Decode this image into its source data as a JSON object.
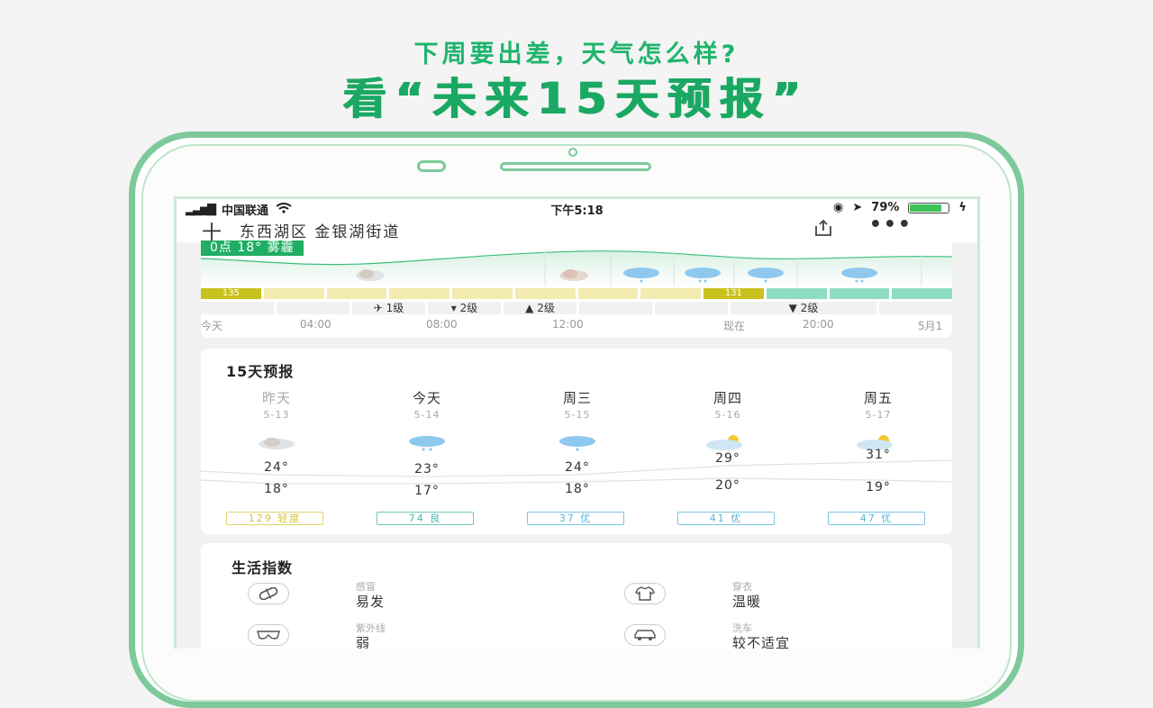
{
  "promo": {
    "line1": "下周要出差，天气怎么样?",
    "line2": "看“未来15天预报”"
  },
  "status": {
    "carrier": "中国联通",
    "time": "下午5:18",
    "battery": "79%"
  },
  "nav": {
    "plus": "十",
    "location": "东西湖区 金银湖街道",
    "more": "•••"
  },
  "hourly": {
    "badge": "0点 18° 雾霾",
    "aqi_start": "135",
    "aqi_now": "131",
    "wind": [
      "1级",
      "2级",
      "2级",
      "2级"
    ],
    "times": [
      "今天",
      "04:00",
      "08:00",
      "12:00",
      "现在",
      "20:00",
      "5月1"
    ]
  },
  "forecast": {
    "title": "15天预报",
    "days": [
      {
        "day": "昨天",
        "date": "5-13",
        "high": "24°",
        "low": "18°",
        "aqi": "129 轻度",
        "icon": "haze-icon"
      },
      {
        "day": "今天",
        "date": "5-14",
        "high": "23°",
        "low": "17°",
        "aqi": "74 良",
        "icon": "rain-icon"
      },
      {
        "day": "周三",
        "date": "5-15",
        "high": "24°",
        "low": "18°",
        "aqi": "37 优",
        "icon": "light-rain-icon"
      },
      {
        "day": "周四",
        "date": "5-16",
        "high": "29°",
        "low": "20°",
        "aqi": "41 优",
        "icon": "partly-sunny-icon"
      },
      {
        "day": "周五",
        "date": "5-17",
        "high": "31°",
        "low": "19°",
        "aqi": "47 优",
        "icon": "partly-sunny-icon"
      }
    ]
  },
  "life": {
    "title": "生活指数",
    "items": [
      {
        "label": "感冒",
        "value": "易发",
        "icon": "pill-icon"
      },
      {
        "label": "穿衣",
        "value": "温暖",
        "icon": "tshirt-icon"
      },
      {
        "label": "紫外线",
        "value": "弱",
        "icon": "sunglasses-icon"
      },
      {
        "label": "洗车",
        "value": "较不适宜",
        "icon": "car-icon"
      }
    ]
  },
  "colors": {
    "brand": "#1aa863",
    "aqi_slight": "#c9c21c",
    "aqi_good": "#8fdcc4",
    "bar_yellow": "#f3ebb0"
  }
}
